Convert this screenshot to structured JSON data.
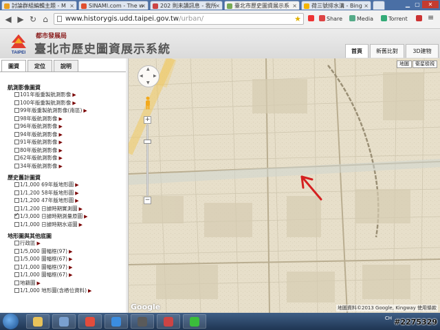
{
  "browser": {
    "tabs": [
      {
        "label": "討論群組編輯主題 - M",
        "favicon_color": "#e8a020"
      },
      {
        "label": "SINAMI.com - The w",
        "favicon_color": "#e05030"
      },
      {
        "label": "202 則未讀訊息 - 我所",
        "favicon_color": "#c44"
      },
      {
        "label": "臺北市歷史圖資展示系",
        "favicon_color": "#7a5"
      },
      {
        "label": "荷三號排水溝 - Bing",
        "favicon_color": "#f4b400"
      }
    ],
    "url_host": "www.historygis.udd.taipei.gov.tw",
    "url_path": "/urban/",
    "extensions": [
      {
        "label": "Share",
        "color": "#d44"
      },
      {
        "label": "Media",
        "color": "#5a8"
      },
      {
        "label": "Torrent",
        "color": "#3a7"
      }
    ]
  },
  "site": {
    "bureau": "都市發展局",
    "logo_text": "TAIPEI",
    "title": "臺北市歷史圖資展示系統",
    "nav": [
      "首頁",
      "新舊比對",
      "3D建物"
    ]
  },
  "sidebar": {
    "tabs": [
      "圖資",
      "定位",
      "說明"
    ],
    "sections": [
      {
        "title": "航測影像圖資",
        "items": [
          {
            "label": "101年版重製航測影像",
            "checked": false,
            "arrow": true
          },
          {
            "label": "100年版重製航測影像",
            "checked": false,
            "arrow": true
          },
          {
            "label": "99年版重製航測影像(南區)",
            "checked": false,
            "arrow": true
          },
          {
            "label": "98年版航測影像",
            "checked": false,
            "arrow": true
          },
          {
            "label": "96年版航測影像",
            "checked": false,
            "arrow": true
          },
          {
            "label": "94年版航測影像",
            "checked": false,
            "arrow": true
          },
          {
            "label": "91年版航測影像",
            "checked": false,
            "arrow": true
          },
          {
            "label": "80年版航測影像",
            "checked": false,
            "arrow": true
          },
          {
            "label": "62年版航測影像",
            "checked": false,
            "arrow": true
          },
          {
            "label": "34年版航測影像",
            "checked": false,
            "arrow": true
          }
        ]
      },
      {
        "title": "歷史舊計圖資",
        "items": [
          {
            "label": "1/1,000 69年版地形圖",
            "checked": false,
            "arrow": true
          },
          {
            "label": "1/1,200 58年版地形圖",
            "checked": false,
            "arrow": true
          },
          {
            "label": "1/1,200 47年版地形圖",
            "checked": false,
            "arrow": true
          },
          {
            "label": "1/1,200 日據時期實測圖",
            "checked": false,
            "arrow": true
          },
          {
            "label": "1/3,000 日據時期測量原圖",
            "checked": true,
            "arrow": true
          },
          {
            "label": "1/1,000 日據時期水道圖",
            "checked": false,
            "arrow": true
          }
        ]
      },
      {
        "title": "地形圖與其他底圖",
        "items": [
          {
            "label": "行政區",
            "checked": false,
            "arrow": true
          },
          {
            "label": "1/5,000 圖幅框(97)",
            "checked": false,
            "arrow": true
          },
          {
            "label": "1/5,000 圖幅框(67)",
            "checked": false,
            "arrow": true
          },
          {
            "label": "1/1,000 圖幅框(97)",
            "checked": false,
            "arrow": true
          },
          {
            "label": "1/1,000 圖幅框(67)",
            "checked": false,
            "arrow": true
          },
          {
            "label": "地籍圖",
            "checked": false,
            "arrow": true
          },
          {
            "label": "1/1,000 地形圖(含樁位資料)",
            "checked": false,
            "arrow": true
          }
        ]
      }
    ]
  },
  "map": {
    "type_buttons": [
      "地圖",
      "衛星檢視"
    ],
    "pan_labels": [
      "▲",
      "◀",
      "▶",
      "▼"
    ],
    "zoom_in": "+",
    "zoom_out": "−",
    "google_logo": "Google",
    "copyright": "地圖資料©2013 Google, Kingway   使用條款",
    "annotation_color": "#d42020"
  },
  "taskbar": {
    "apps": [
      {
        "name": "explorer",
        "color": "#e8c25a"
      },
      {
        "name": "network",
        "color": "#7aa0d0"
      },
      {
        "name": "chrome-spiral",
        "color": "#e24c3c"
      },
      {
        "name": "internet-explorer",
        "color": "#3b8de0"
      },
      {
        "name": "world-of-tanks",
        "color": "#5a5a5a"
      },
      {
        "name": "monitor",
        "color": "#c44"
      },
      {
        "name": "line",
        "color": "#3bbd3b"
      }
    ],
    "tray_text": "CH",
    "watermark": "#2275329"
  }
}
